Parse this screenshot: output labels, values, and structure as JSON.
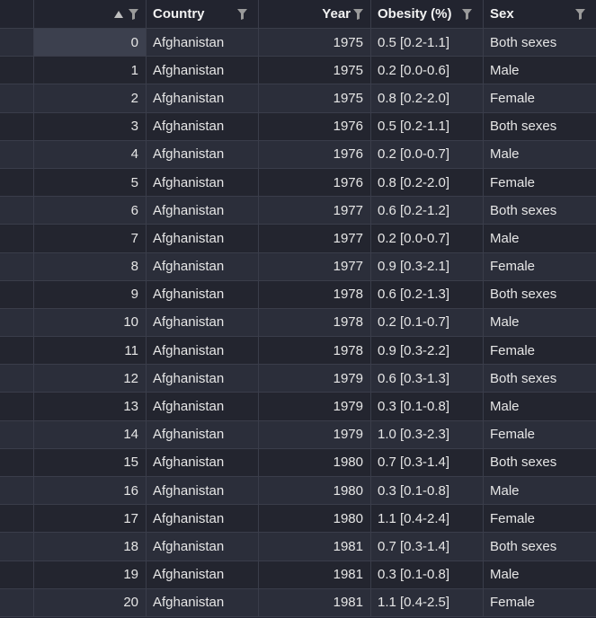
{
  "header": {
    "index_label": "",
    "country_label": "Country",
    "year_label": "Year",
    "obesity_label": "Obesity (%)",
    "sex_label": "Sex",
    "sort_icon": "sort-up-icon",
    "filter_icon": "filter-icon"
  },
  "rows": [
    {
      "idx": "0",
      "country": "Afghanistan",
      "year": "1975",
      "obesity": "0.5 [0.2-1.1]",
      "sex": "Both sexes"
    },
    {
      "idx": "1",
      "country": "Afghanistan",
      "year": "1975",
      "obesity": "0.2 [0.0-0.6]",
      "sex": "Male"
    },
    {
      "idx": "2",
      "country": "Afghanistan",
      "year": "1975",
      "obesity": "0.8 [0.2-2.0]",
      "sex": "Female"
    },
    {
      "idx": "3",
      "country": "Afghanistan",
      "year": "1976",
      "obesity": "0.5 [0.2-1.1]",
      "sex": "Both sexes"
    },
    {
      "idx": "4",
      "country": "Afghanistan",
      "year": "1976",
      "obesity": "0.2 [0.0-0.7]",
      "sex": "Male"
    },
    {
      "idx": "5",
      "country": "Afghanistan",
      "year": "1976",
      "obesity": "0.8 [0.2-2.0]",
      "sex": "Female"
    },
    {
      "idx": "6",
      "country": "Afghanistan",
      "year": "1977",
      "obesity": "0.6 [0.2-1.2]",
      "sex": "Both sexes"
    },
    {
      "idx": "7",
      "country": "Afghanistan",
      "year": "1977",
      "obesity": "0.2 [0.0-0.7]",
      "sex": "Male"
    },
    {
      "idx": "8",
      "country": "Afghanistan",
      "year": "1977",
      "obesity": "0.9 [0.3-2.1]",
      "sex": "Female"
    },
    {
      "idx": "9",
      "country": "Afghanistan",
      "year": "1978",
      "obesity": "0.6 [0.2-1.3]",
      "sex": "Both sexes"
    },
    {
      "idx": "10",
      "country": "Afghanistan",
      "year": "1978",
      "obesity": "0.2 [0.1-0.7]",
      "sex": "Male"
    },
    {
      "idx": "11",
      "country": "Afghanistan",
      "year": "1978",
      "obesity": "0.9 [0.3-2.2]",
      "sex": "Female"
    },
    {
      "idx": "12",
      "country": "Afghanistan",
      "year": "1979",
      "obesity": "0.6 [0.3-1.3]",
      "sex": "Both sexes"
    },
    {
      "idx": "13",
      "country": "Afghanistan",
      "year": "1979",
      "obesity": "0.3 [0.1-0.8]",
      "sex": "Male"
    },
    {
      "idx": "14",
      "country": "Afghanistan",
      "year": "1979",
      "obesity": "1.0 [0.3-2.3]",
      "sex": "Female"
    },
    {
      "idx": "15",
      "country": "Afghanistan",
      "year": "1980",
      "obesity": "0.7 [0.3-1.4]",
      "sex": "Both sexes"
    },
    {
      "idx": "16",
      "country": "Afghanistan",
      "year": "1980",
      "obesity": "0.3 [0.1-0.8]",
      "sex": "Male"
    },
    {
      "idx": "17",
      "country": "Afghanistan",
      "year": "1980",
      "obesity": "1.1 [0.4-2.4]",
      "sex": "Female"
    },
    {
      "idx": "18",
      "country": "Afghanistan",
      "year": "1981",
      "obesity": "0.7 [0.3-1.4]",
      "sex": "Both sexes"
    },
    {
      "idx": "19",
      "country": "Afghanistan",
      "year": "1981",
      "obesity": "0.3 [0.1-0.8]",
      "sex": "Male"
    },
    {
      "idx": "20",
      "country": "Afghanistan",
      "year": "1981",
      "obesity": "1.1 [0.4-2.5]",
      "sex": "Female"
    }
  ],
  "colors": {
    "background": "#222431",
    "row_alt": "#2b2e3a",
    "selected_cell": "#3c404e",
    "text": "#e6e6e6",
    "border": "#3a3d4a"
  }
}
